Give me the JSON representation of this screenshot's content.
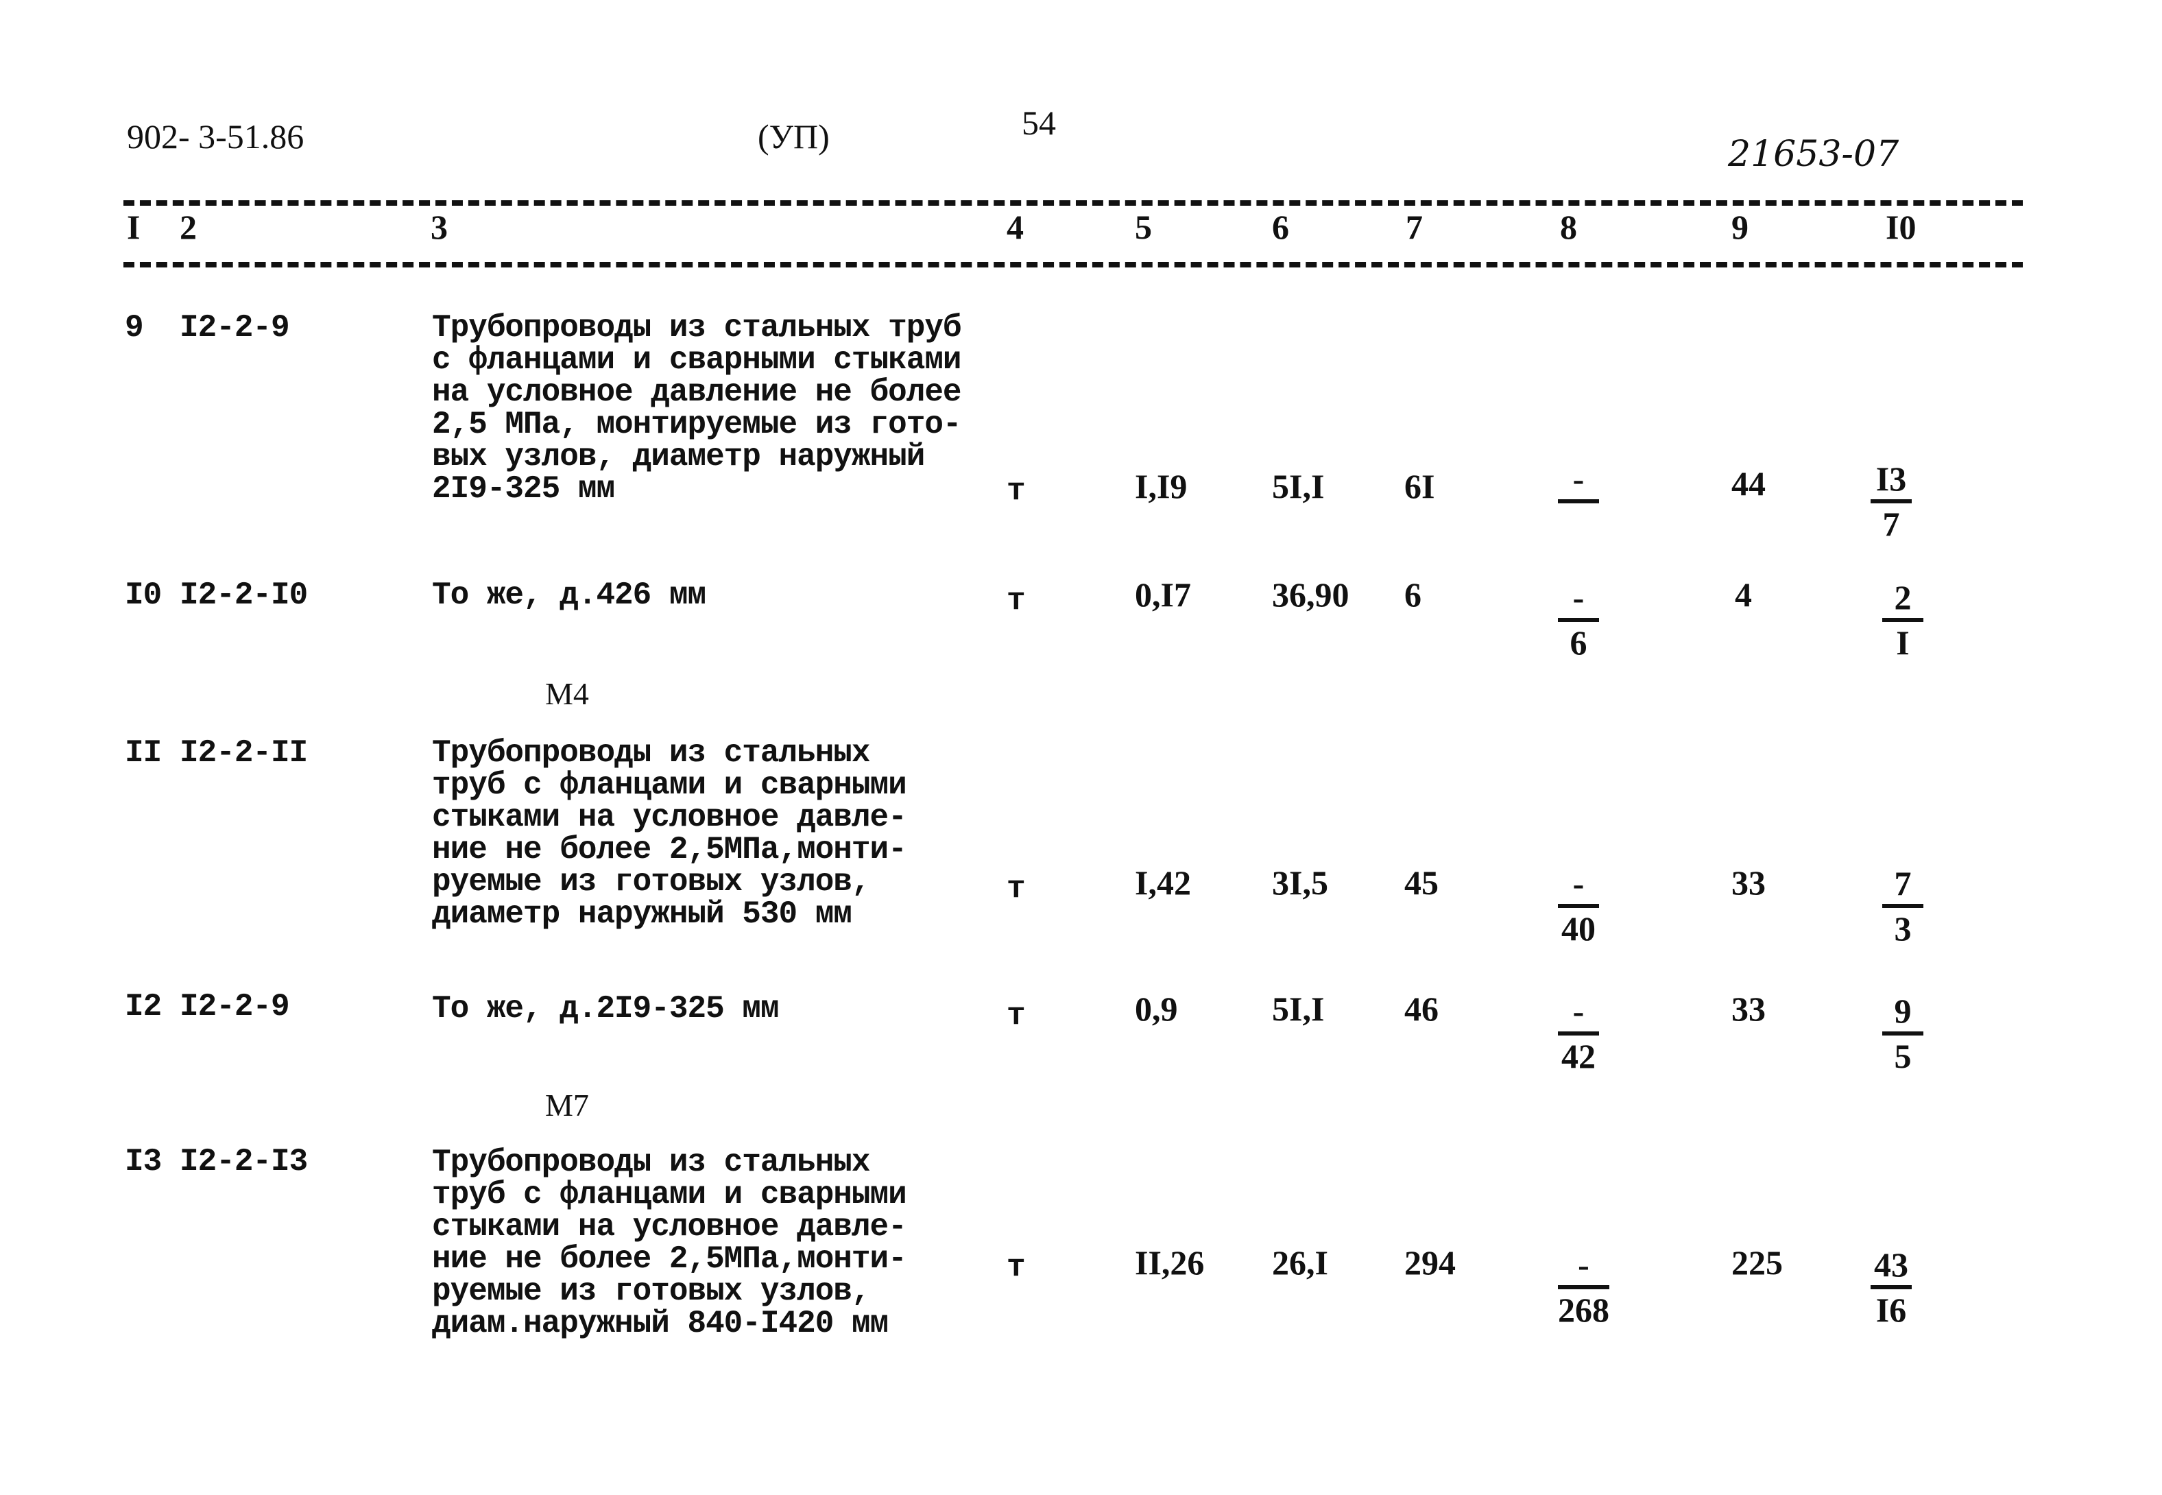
{
  "header": {
    "doc_code": "902- 3-51.86",
    "section_mark": "(УП)",
    "page_number": "54",
    "handwritten_ref": "21653-07"
  },
  "columns": [
    "I",
    "2",
    "3",
    "4",
    "5",
    "6",
    "7",
    "8",
    "9",
    "I0"
  ],
  "rows": [
    {
      "num": "9",
      "code": "I2-2-9",
      "desc": "Трубопроводы из стальных труб\nс фланцами и сварными стыками\nна условное давление не более\n2,5 МПа, монтируемые из гото-\nвых узлов, диаметр наружный\n2I9-325 мм",
      "unit": "т",
      "c5": "I,I9",
      "c6": "5I,I",
      "c7": "6I",
      "c8_top": "-",
      "c8_bot": "",
      "c9": "44",
      "c10_top": "I3",
      "c10_bot": "7"
    },
    {
      "num": "I0",
      "code": "I2-2-I0",
      "desc": "То же, д.426 мм",
      "unit": "т",
      "c5": "0,I7",
      "c6": "36,90",
      "c7": "6",
      "c8_top": "-",
      "c8_bot": "6",
      "c9": "4",
      "c10_top": "2",
      "c10_bot": "I"
    },
    {
      "num": "II",
      "code": "I2-2-II",
      "desc": "Трубопроводы из стальных\nтруб с фланцами и сварными\nстыками на условное давле-\nние не более 2,5МПа,монти-\nруемые из готовых узлов,\nдиаметр наружный 530 мм",
      "unit": "т",
      "c5": "I,42",
      "c6": "3I,5",
      "c7": "45",
      "c8_top": "-",
      "c8_bot": "40",
      "c9": "33",
      "c10_top": "7",
      "c10_bot": "3"
    },
    {
      "num": "I2",
      "code": "I2-2-9",
      "desc": "То же, д.2I9-325 мм",
      "unit": "т",
      "c5": "0,9",
      "c6": "5I,I",
      "c7": "46",
      "c8_top": "-",
      "c8_bot": "42",
      "c9": "33",
      "c10_top": "9",
      "c10_bot": "5"
    },
    {
      "num": "I3",
      "code": "I2-2-I3",
      "desc": "Трубопроводы из стальных\nтруб с фланцами и сварными\nстыками на условное давле-\nние не более 2,5МПа,монти-\nруемые из готовых узлов,\nдиам.наружный 840-I420 мм",
      "unit": "т",
      "c5": "II,26",
      "c6": "26,I",
      "c7": "294",
      "c8_top": "-",
      "c8_bot": "268",
      "c9": "225",
      "c10_top": "43",
      "c10_bot": "I6"
    }
  ],
  "section_labels": [
    "М4",
    "М7"
  ]
}
